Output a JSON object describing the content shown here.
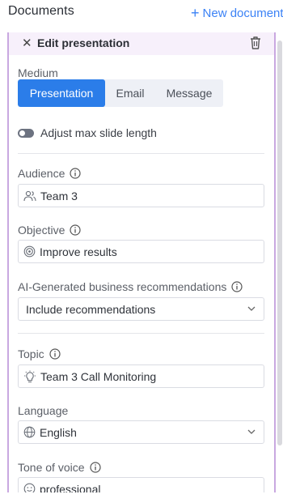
{
  "topbar": {
    "title": "Documents",
    "new_label": "New document"
  },
  "panel": {
    "title": "Edit presentation",
    "medium": {
      "label": "Medium",
      "options": [
        "Presentation",
        "Email",
        "Message"
      ],
      "selected": "Presentation"
    },
    "toggle_label": "Adjust max slide length",
    "audience": {
      "label": "Audience",
      "value": "Team 3"
    },
    "objective": {
      "label": "Objective",
      "value": "Improve results"
    },
    "recommendations": {
      "label": "AI-Generated business recommendations",
      "value": "Include recommendations"
    },
    "topic": {
      "label": "Topic",
      "value": "Team 3 Call Monitoring"
    },
    "language": {
      "label": "Language",
      "value": "English"
    },
    "tone": {
      "label": "Tone of voice",
      "value": "professional"
    }
  },
  "colors": {
    "accent": "#2b7de9",
    "link": "#3b82f6",
    "panel_border": "#c9a8e0"
  }
}
